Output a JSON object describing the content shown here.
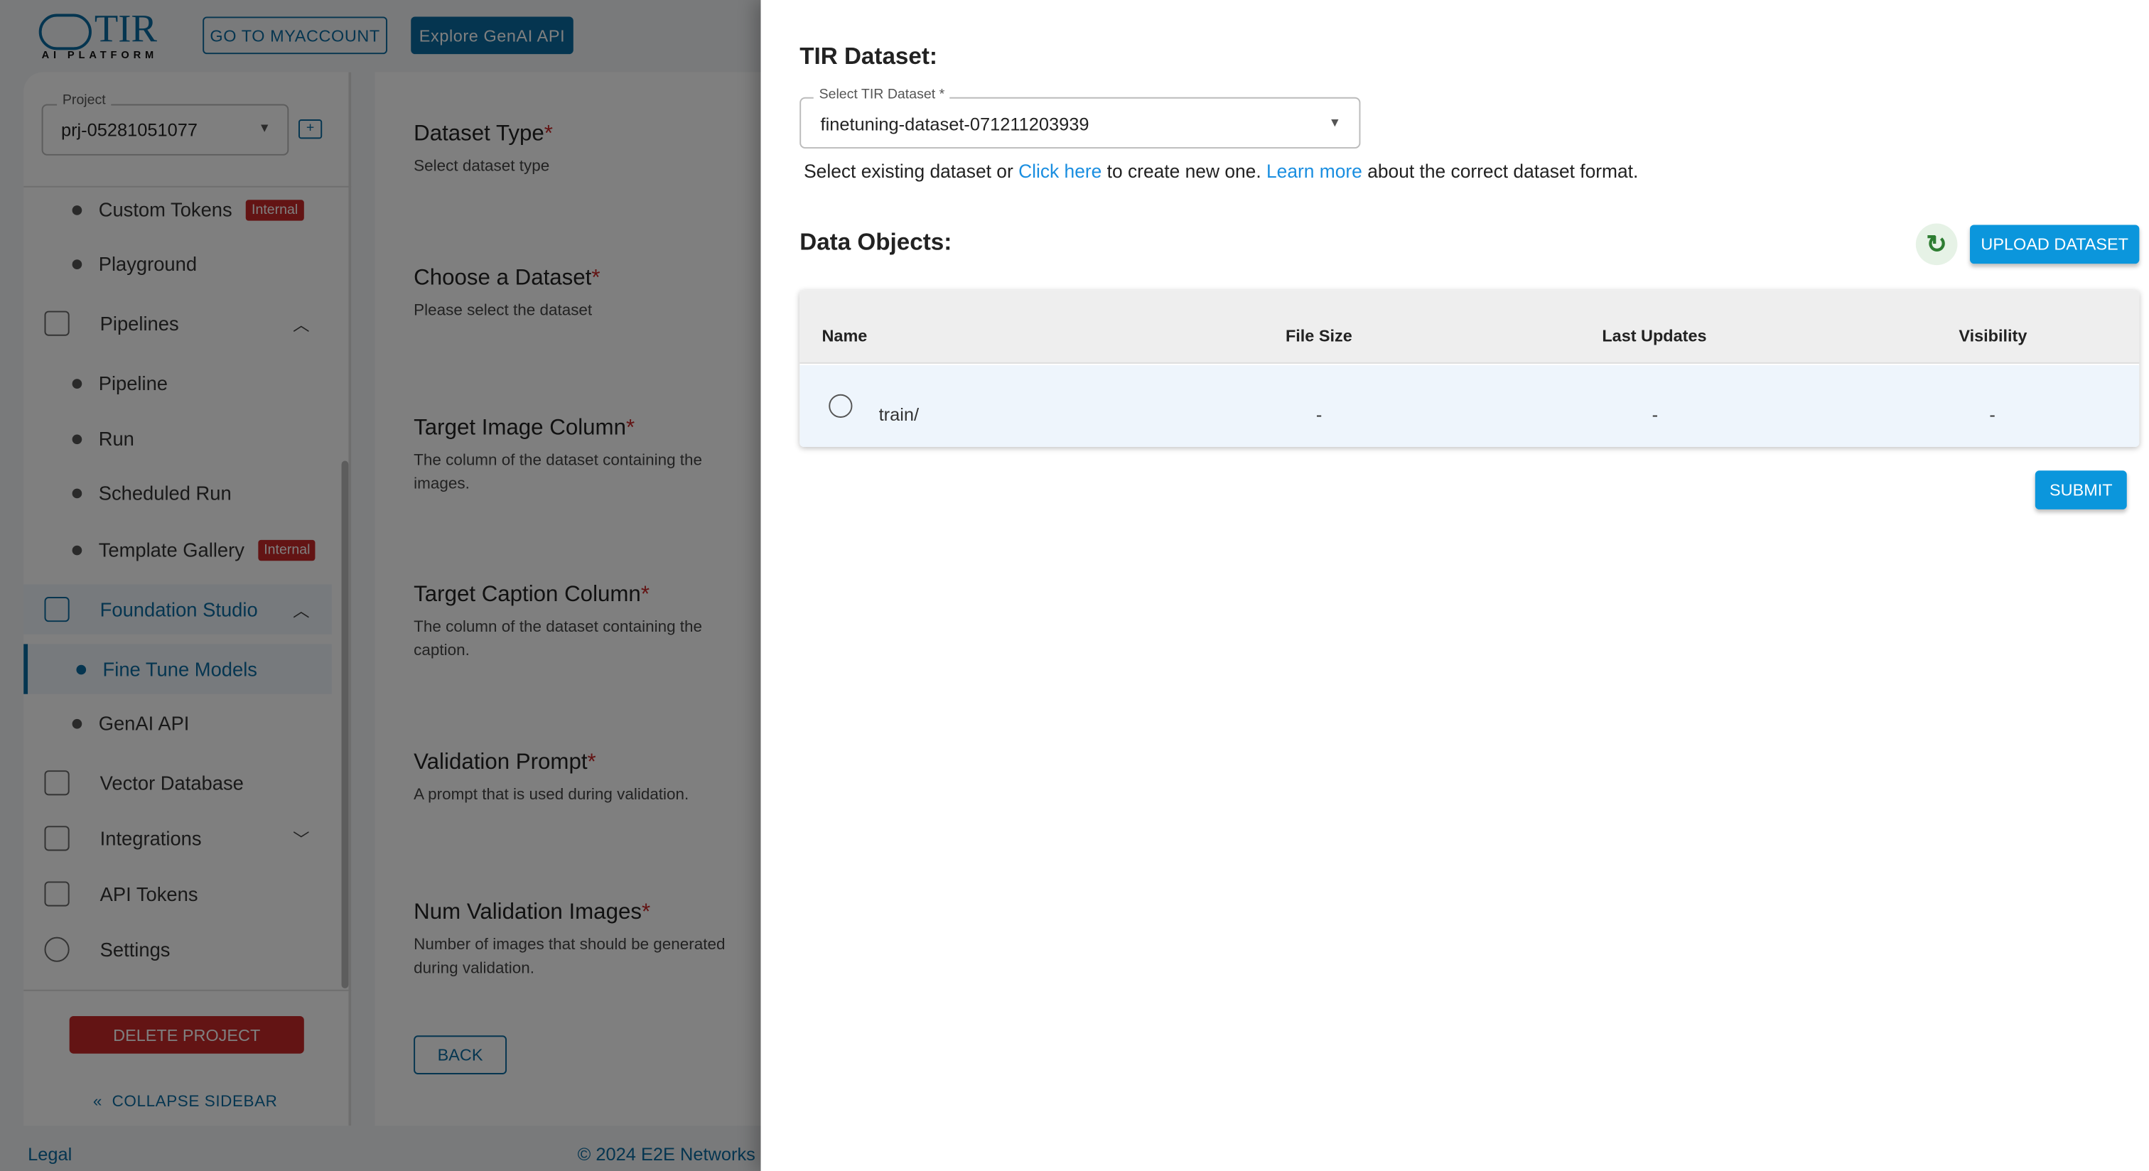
{
  "header": {
    "logo_text": "TIR",
    "logo_sub": "AI PLATFORM",
    "myaccount_button": "GO TO MYACCOUNT",
    "genai_button": "Explore GenAI API"
  },
  "sidebar": {
    "project_label": "Project",
    "project_value": "prj-05281051077",
    "items": [
      {
        "label": "Custom Tokens",
        "badge": "Internal"
      },
      {
        "label": "Playground"
      },
      {
        "label": "Pipelines"
      },
      {
        "label": "Pipeline"
      },
      {
        "label": "Run"
      },
      {
        "label": "Scheduled Run"
      },
      {
        "label": "Template Gallery",
        "badge": "Internal"
      },
      {
        "label": "Foundation Studio"
      },
      {
        "label": "Fine Tune Models"
      },
      {
        "label": "GenAI API"
      },
      {
        "label": "Vector Database"
      },
      {
        "label": "Integrations"
      },
      {
        "label": "API Tokens"
      },
      {
        "label": "Settings"
      }
    ],
    "delete_button": "DELETE PROJECT",
    "collapse_button": "COLLAPSE SIDEBAR"
  },
  "main": {
    "fields": [
      {
        "title": "Dataset Type",
        "desc": "Select dataset type"
      },
      {
        "title": "Choose a Dataset",
        "desc": "Please select the dataset"
      },
      {
        "title": "Target Image Column",
        "desc": "The column of the dataset containing the images."
      },
      {
        "title": "Target Caption Column",
        "desc": "The column of the dataset containing the caption."
      },
      {
        "title": "Validation Prompt",
        "desc": "A prompt that is used during validation."
      },
      {
        "title": "Num Validation Images",
        "desc": "Number of images that should be generated during validation."
      }
    ],
    "required_mark": "*",
    "back_button": "BACK"
  },
  "footer": {
    "legal": "Legal",
    "copyright": "© 2024 E2E Networks"
  },
  "drawer": {
    "title": "TIR Dataset:",
    "select_label": "Select TIR Dataset *",
    "select_value": "finetuning-dataset-071211203939",
    "help": {
      "pre": "Select existing dataset or ",
      "link1": "Click here",
      "mid": " to create new one. ",
      "link2": "Learn more",
      "post": " about the correct dataset format."
    },
    "objects_title": "Data Objects:",
    "upload_button": "UPLOAD DATASET",
    "table": {
      "headers": [
        "Name",
        "File Size",
        "Last Updates",
        "Visibility"
      ],
      "rows": [
        [
          "train/",
          "-",
          "-",
          "-"
        ]
      ]
    },
    "submit_button": "SUBMIT"
  },
  "colors": {
    "accent": "#0b86d1",
    "brand": "#0b6ba0",
    "danger": "#c62828",
    "refresh": "#2e7d32"
  }
}
